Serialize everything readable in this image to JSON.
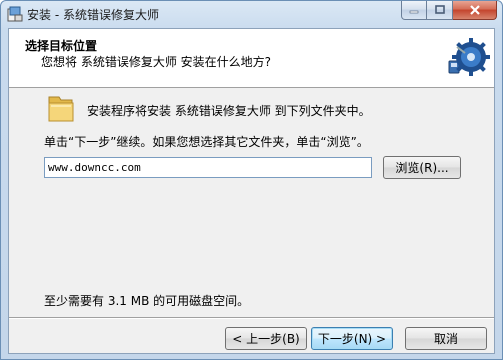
{
  "window": {
    "title": "安装 - 系统错误修复大师"
  },
  "header": {
    "title": "选择目标位置",
    "subtitle": "您想将 系统错误修复大师 安装在什么地方?"
  },
  "body": {
    "info": "安装程序将安装 系统错误修复大师 到下列文件夹中。",
    "instruction": "单击“下一步”继续。如果您想选择其它文件夹，单击“浏览”。",
    "path_value": "www.downcc.com",
    "browse_label": "浏览(R)...",
    "space_required": "至少需要有 3.1 MB 的可用磁盘空间。"
  },
  "footer": {
    "back_label": "< 上一步(B)",
    "next_label": "下一步(N) >",
    "cancel_label": "取消"
  },
  "colors": {
    "accent": "#3c7fb1",
    "header_bg": "#ffffff",
    "client_bg": "#f0f0f0"
  },
  "icons": [
    "setup-app-icon",
    "minimize-icon",
    "maximize-icon",
    "close-icon",
    "disk-install-icon",
    "folder-icon"
  ]
}
